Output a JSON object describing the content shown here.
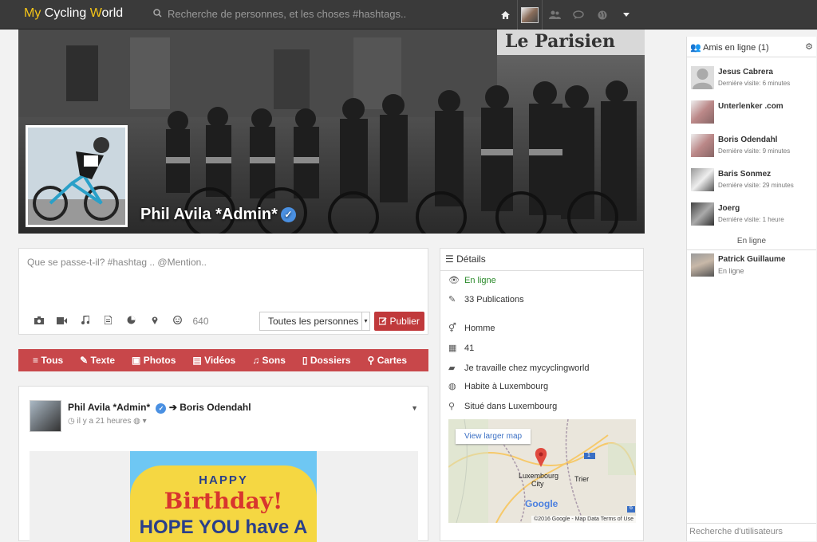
{
  "app": {
    "logo_my": "My",
    "logo_rest_a": "Cycling",
    "logo_w": "W",
    "logo_rest_b": "orld",
    "search_placeholder": "Recherche de personnes, et les choses #hashtags.."
  },
  "profile": {
    "name": "Phil Avila *Admin*",
    "verified_glyph": "✓",
    "cover_sign": "Le Parisien"
  },
  "composer": {
    "placeholder": "Que se passe-t-il? #hashtag .. @Mention..",
    "char_count": "640",
    "audience": "Toutes les personnes",
    "publish_label": "Publier"
  },
  "filters": [
    {
      "icon": "≡",
      "label": "Tous"
    },
    {
      "icon": "✎",
      "label": "Texte"
    },
    {
      "icon": "▣",
      "label": "Photos"
    },
    {
      "icon": "▤",
      "label": "Vidéos"
    },
    {
      "icon": "♫",
      "label": "Sons"
    },
    {
      "icon": "▯",
      "label": "Dossiers"
    },
    {
      "icon": "⚲",
      "label": "Cartes"
    }
  ],
  "post": {
    "author": "Phil Avila *Admin*",
    "arrow": "➔",
    "target": "Boris Odendahl",
    "time": "il y a 21 heures",
    "card_line1": "HAPPY",
    "card_line2": "Birthday!",
    "card_line3": "HOPE YOU have A"
  },
  "details": {
    "title": "Détails",
    "status": "En ligne",
    "publications": "33 Publications",
    "gender": "Homme",
    "age": "41",
    "work": "Je travaille chez mycyclingworld",
    "lives": "Habite à Luxembourg",
    "located": "Situé dans Luxembourg",
    "map": {
      "view_larger": "View larger map",
      "city": "Luxembourg",
      "city2": "City",
      "trier": "Trier",
      "attribution": "©2016 Google - Map Data    Terms of Use",
      "google": "Google",
      "road1": "1",
      "road6": "6"
    }
  },
  "sidebar": {
    "title": "Amis en ligne (1)",
    "friends": [
      {
        "name": "Jesus Cabrera",
        "sub": "Dernière visite: 6 minutes"
      },
      {
        "name": "Unterlenker .com",
        "sub": ""
      },
      {
        "name": "Boris Odendahl",
        "sub": "Dernière visite: 9 minutes"
      },
      {
        "name": "Baris Sonmez",
        "sub": "Dernière visite: 29 minutes"
      },
      {
        "name": "Joerg",
        "sub": "Dernière visite: 1 heure"
      }
    ],
    "online_label": "En ligne",
    "online_friend": {
      "name": "Patrick Guillaume",
      "sub": "En ligne"
    },
    "search_placeholder": "Recherche d'utilisateurs"
  },
  "colors": {
    "accent_red": "#c0393b",
    "logo_yellow": "#f5c518",
    "online_green": "#2a8a2a",
    "verified_blue": "#4a90e2"
  }
}
